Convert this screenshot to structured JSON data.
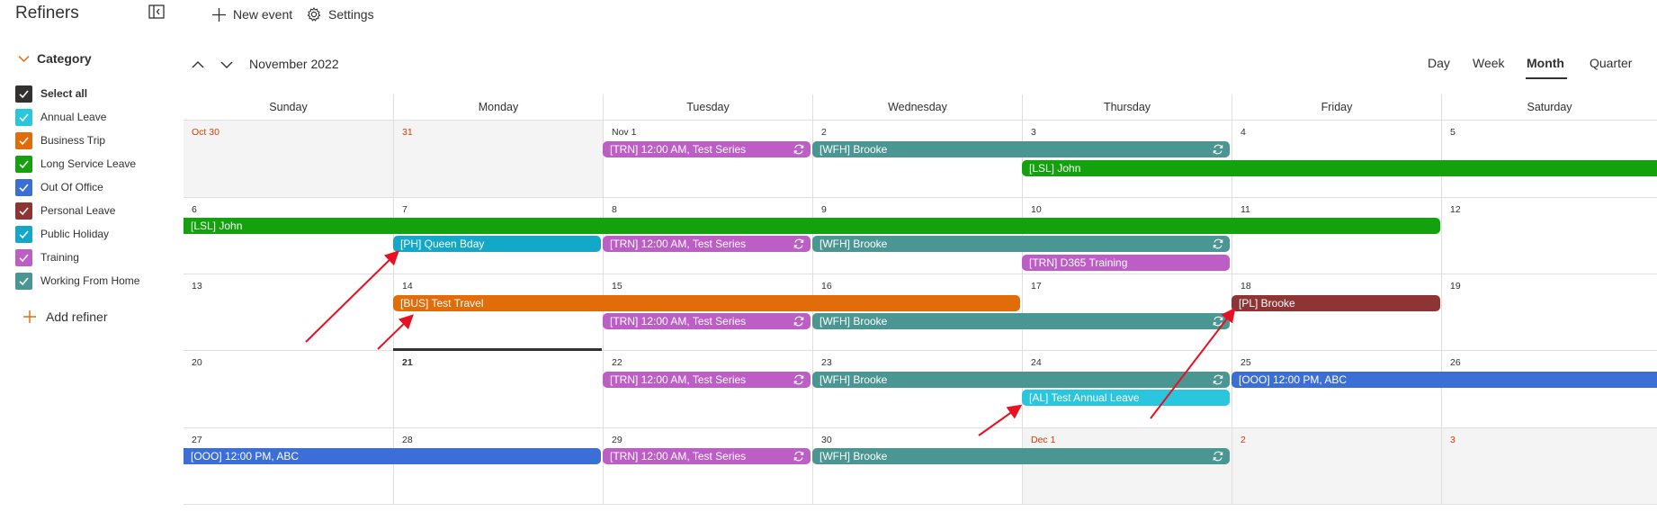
{
  "sidebar": {
    "title": "Refiners",
    "category_label": "Category",
    "add_refiner": "Add refiner",
    "items": [
      {
        "label": "Select all",
        "color": "#323130"
      },
      {
        "label": "Annual Leave",
        "color": "#29c6dd"
      },
      {
        "label": "Business Trip",
        "color": "#e36c0a"
      },
      {
        "label": "Long Service Leave",
        "color": "#13a10e"
      },
      {
        "label": "Out Of Office",
        "color": "#3b6fd6"
      },
      {
        "label": "Personal Leave",
        "color": "#8e3434"
      },
      {
        "label": "Public Holiday",
        "color": "#14a8c8"
      },
      {
        "label": "Training",
        "color": "#bd5dc6"
      },
      {
        "label": "Working From Home",
        "color": "#4a9692"
      }
    ]
  },
  "toolbar": {
    "new_event": "New event",
    "settings": "Settings"
  },
  "nav": {
    "month_label": "November 2022"
  },
  "views": [
    "Day",
    "Week",
    "Month",
    "Quarter"
  ],
  "active_view": "Month",
  "days": [
    "Sunday",
    "Monday",
    "Tuesday",
    "Wednesday",
    "Thursday",
    "Friday",
    "Saturday"
  ],
  "weeks": [
    [
      "Oct 30",
      "31",
      "Nov 1",
      "2",
      "3",
      "4",
      "5"
    ],
    [
      "6",
      "7",
      "8",
      "9",
      "10",
      "11",
      "12"
    ],
    [
      "13",
      "14",
      "15",
      "16",
      "17",
      "18",
      "19"
    ],
    [
      "20",
      "21",
      "22",
      "23",
      "24",
      "25",
      "26"
    ],
    [
      "27",
      "28",
      "29",
      "30",
      "Dec 1",
      "2",
      "3"
    ]
  ],
  "events": {
    "trn_series": "[TRN]  12:00 AM, Test Series",
    "wfh_brooke": "[WFH]  Brooke",
    "lsl_john": "[LSL]  John",
    "ph_queen": "[PH]  Queen Bday",
    "trn_d365": "[TRN]  D365 Training",
    "bus_travel": "[BUS]  Test Travel",
    "pl_brooke": "[PL]  Brooke",
    "ooo_abc": "[OOO]  12:00 PM, ABC",
    "al_test": "[AL]  Test Annual Leave"
  },
  "colors": {
    "training": "#bd5dc6",
    "wfh": "#4a9692",
    "lsl": "#13a10e",
    "ph": "#14a8c8",
    "bus": "#e36c0a",
    "pl": "#8e3434",
    "ooo": "#3b6fd6",
    "al": "#29c6dd",
    "arrow": "#e81123"
  }
}
